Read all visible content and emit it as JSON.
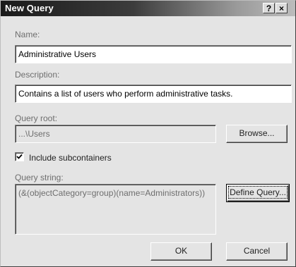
{
  "dialog": {
    "title": "New Query",
    "help_button": "?",
    "close_button": "×"
  },
  "name": {
    "label": "Name:",
    "value": "Administrative Users"
  },
  "description": {
    "label": "Description:",
    "value": "Contains a list of users who perform administrative tasks."
  },
  "query_root": {
    "label": "Query root:",
    "value": "...\\Users",
    "browse_label": "Browse..."
  },
  "include_subcontainers": {
    "label": "Include subcontainers",
    "checked": true
  },
  "query_string": {
    "label": "Query string:",
    "value": "(&(objectCategory=group)(name=Administrators))",
    "define_label": "Define Query..."
  },
  "actions": {
    "ok_label": "OK",
    "cancel_label": "Cancel"
  }
}
